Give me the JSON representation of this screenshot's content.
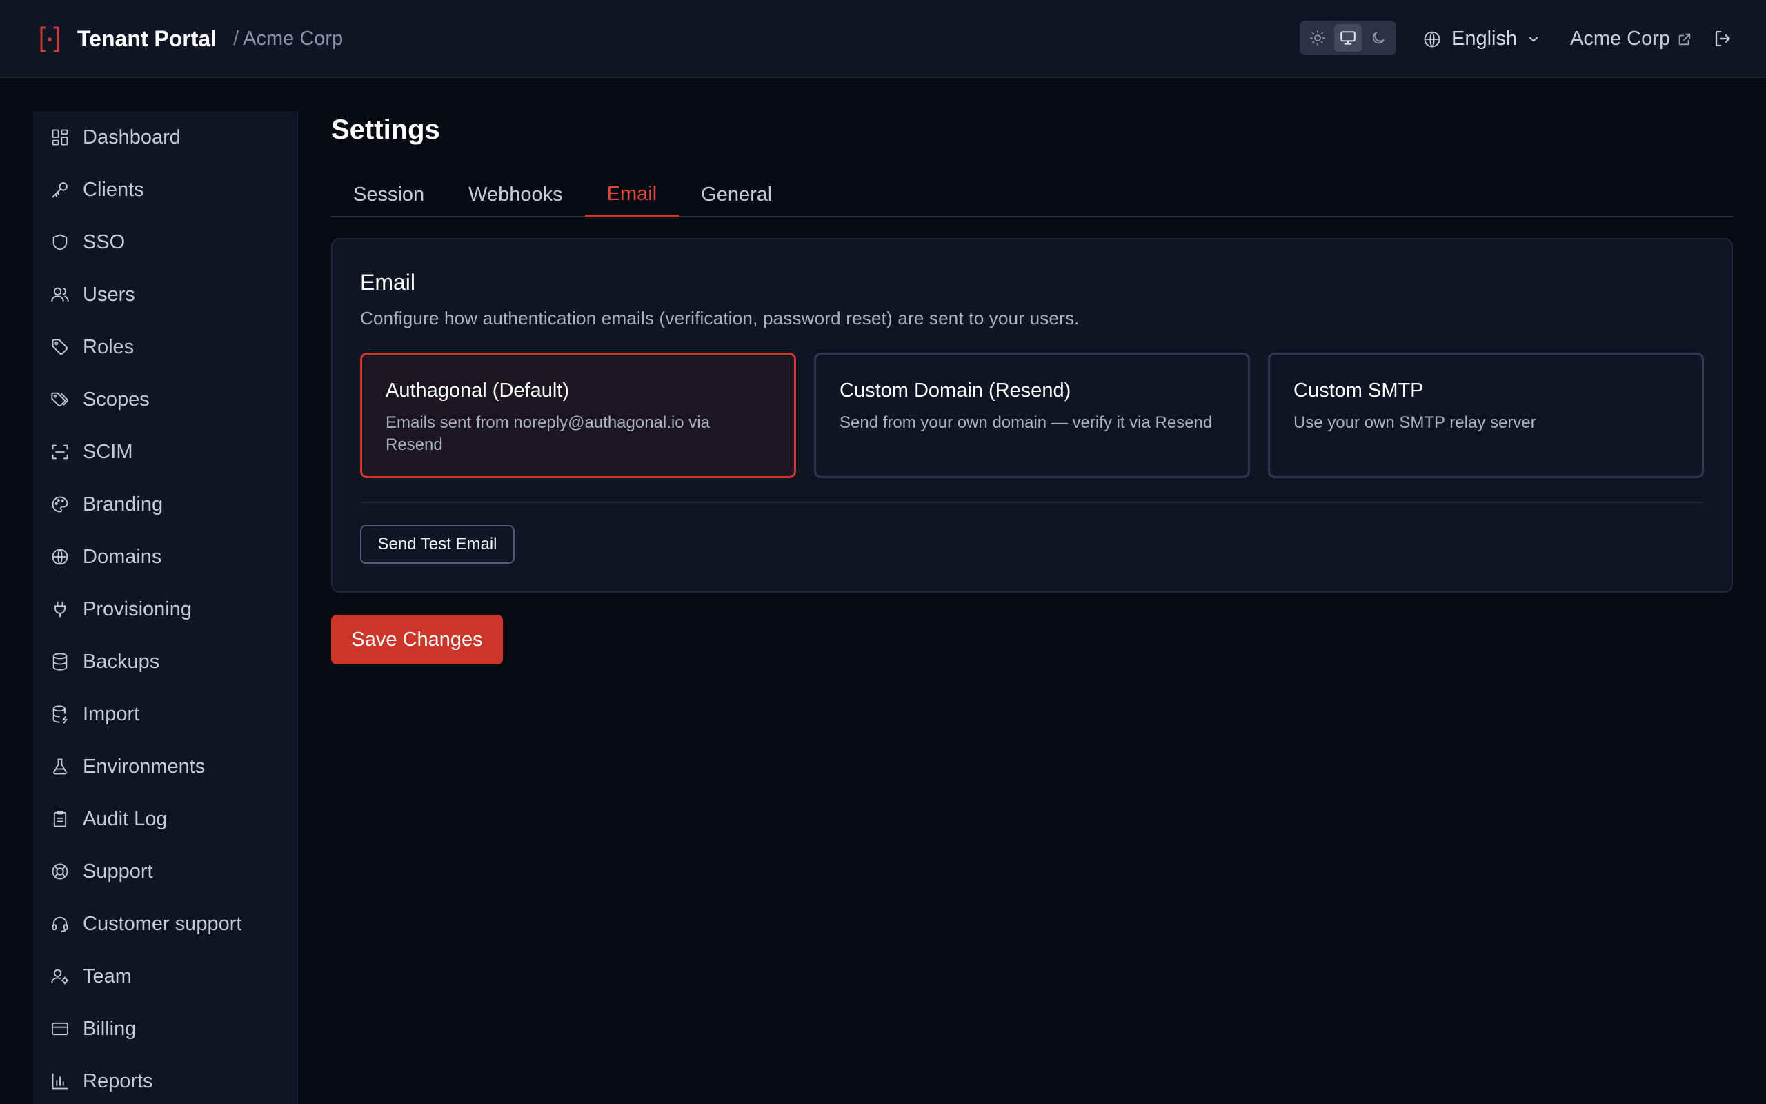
{
  "header": {
    "title": "Tenant Portal",
    "separator": "/",
    "org_breadcrumb": "Acme Corp",
    "language": "English",
    "org_link": "Acme Corp",
    "theme_options": [
      "light",
      "system",
      "dark"
    ],
    "theme_selected": "system"
  },
  "sidebar": {
    "items": [
      {
        "label": "Dashboard",
        "icon": "dashboard-icon"
      },
      {
        "label": "Clients",
        "icon": "key-icon"
      },
      {
        "label": "SSO",
        "icon": "shield-icon"
      },
      {
        "label": "Users",
        "icon": "users-icon"
      },
      {
        "label": "Roles",
        "icon": "tag-icon"
      },
      {
        "label": "Scopes",
        "icon": "tags-icon"
      },
      {
        "label": "SCIM",
        "icon": "scan-icon"
      },
      {
        "label": "Branding",
        "icon": "palette-icon"
      },
      {
        "label": "Domains",
        "icon": "globe-icon"
      },
      {
        "label": "Provisioning",
        "icon": "plug-icon"
      },
      {
        "label": "Backups",
        "icon": "database-icon"
      },
      {
        "label": "Import",
        "icon": "database-import-icon"
      },
      {
        "label": "Environments",
        "icon": "flask-icon"
      },
      {
        "label": "Audit Log",
        "icon": "clipboard-icon"
      },
      {
        "label": "Support",
        "icon": "lifebuoy-icon"
      },
      {
        "label": "Customer support",
        "icon": "headset-icon"
      },
      {
        "label": "Team",
        "icon": "user-cog-icon"
      },
      {
        "label": "Billing",
        "icon": "credit-card-icon"
      },
      {
        "label": "Reports",
        "icon": "bar-chart-icon"
      }
    ]
  },
  "main": {
    "title": "Settings",
    "tabs": [
      {
        "label": "Session"
      },
      {
        "label": "Webhooks"
      },
      {
        "label": "Email"
      },
      {
        "label": "General"
      }
    ],
    "active_tab": "Email",
    "card": {
      "title": "Email",
      "description": "Configure how authentication emails (verification, password reset) are sent to your users.",
      "options": [
        {
          "title": "Authagonal (Default)",
          "description": "Emails sent from noreply@authagonal.io via Resend",
          "selected": true
        },
        {
          "title": "Custom Domain (Resend)",
          "description": "Send from your own domain — verify it via Resend",
          "selected": false
        },
        {
          "title": "Custom SMTP",
          "description": "Use your own SMTP relay server",
          "selected": false
        }
      ],
      "test_button": "Send Test Email"
    },
    "save_button": "Save Changes"
  },
  "colors": {
    "accent": "#d3372f",
    "background": "#050a13",
    "panel": "#0e1625"
  }
}
